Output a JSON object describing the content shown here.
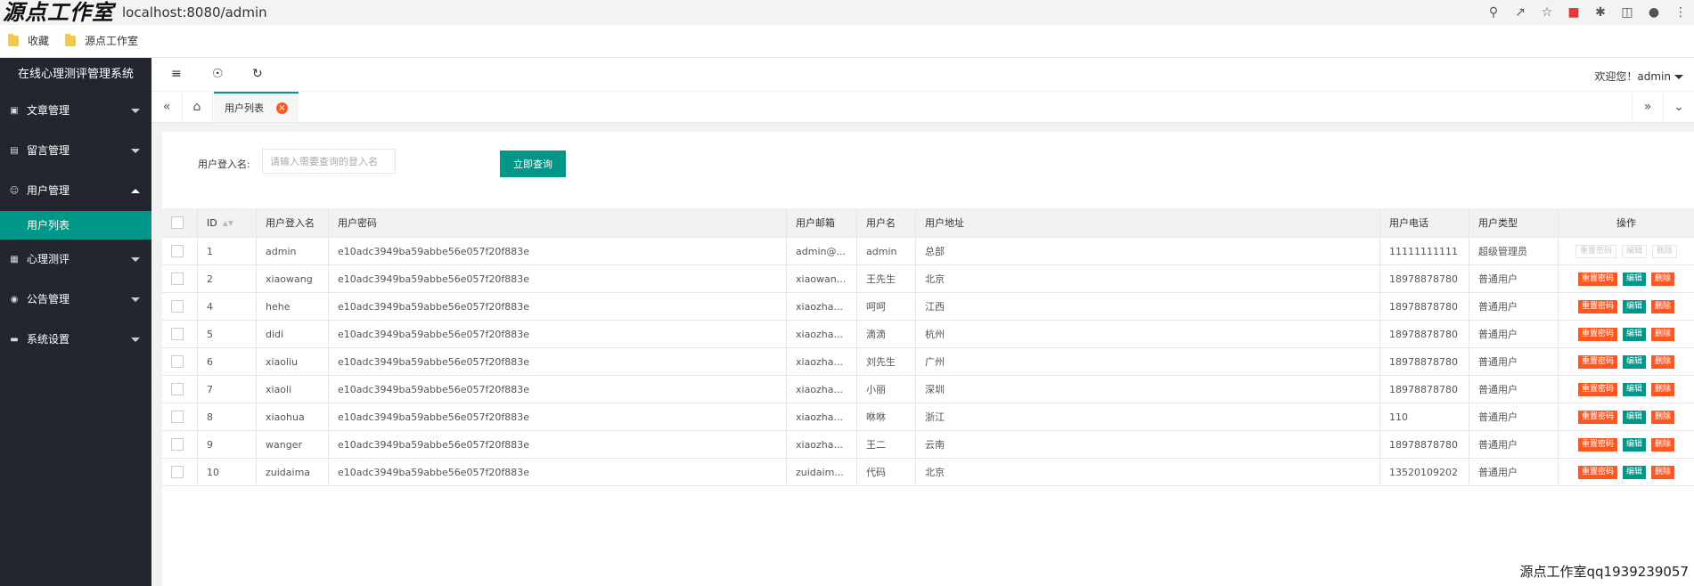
{
  "browser": {
    "logo": "源点工作室",
    "url": "localhost:8080/admin",
    "bookmarks": [
      "收藏",
      "源点工作室"
    ]
  },
  "sidebar": {
    "title": "在线心理测评管理系统",
    "items": [
      {
        "label": "文章管理",
        "icon": "article-icon"
      },
      {
        "label": "留言管理",
        "icon": "message-icon"
      },
      {
        "label": "用户管理",
        "icon": "user-icon",
        "expanded": true
      },
      {
        "label": "心理测评",
        "icon": "assessment-icon"
      },
      {
        "label": "公告管理",
        "icon": "notice-icon"
      },
      {
        "label": "系统设置",
        "icon": "settings-icon"
      }
    ],
    "active_sub": "用户列表"
  },
  "header": {
    "welcome": "欢迎您！admin"
  },
  "tabs": {
    "active": "用户列表"
  },
  "search": {
    "label": "用户登入名:",
    "placeholder": "请输入需要查询的登入名",
    "button": "立即查询"
  },
  "table": {
    "columns": [
      "ID",
      "用户登入名",
      "用户密码",
      "用户邮箱",
      "用户名",
      "用户地址",
      "用户电话",
      "用户类型",
      "操作"
    ],
    "rows": [
      [
        "1",
        "admin",
        "e10adc3949ba59abbe56e057f20f883e",
        "admin@...",
        "admin",
        "总部",
        "11111111111",
        "超级管理员"
      ],
      [
        "2",
        "xiaowang",
        "e10adc3949ba59abbe56e057f20f883e",
        "xiaowan...",
        "王先生",
        "北京",
        "18978878780",
        "普通用户"
      ],
      [
        "4",
        "hehe",
        "e10adc3949ba59abbe56e057f20f883e",
        "xiaozha...",
        "呵呵",
        "江西",
        "18978878780",
        "普通用户"
      ],
      [
        "5",
        "didi",
        "e10adc3949ba59abbe56e057f20f883e",
        "xiaozha...",
        "滴滴",
        "杭州",
        "18978878780",
        "普通用户"
      ],
      [
        "6",
        "xiaoliu",
        "e10adc3949ba59abbe56e057f20f883e",
        "xiaozha...",
        "刘先生",
        "广州",
        "18978878780",
        "普通用户"
      ],
      [
        "7",
        "xiaoli",
        "e10adc3949ba59abbe56e057f20f883e",
        "xiaozha...",
        "小丽",
        "深圳",
        "18978878780",
        "普通用户"
      ],
      [
        "8",
        "xiaohua",
        "e10adc3949ba59abbe56e057f20f883e",
        "xiaozha...",
        "咻咻",
        "浙江",
        "110",
        "普通用户"
      ],
      [
        "9",
        "wanger",
        "e10adc3949ba59abbe56e057f20f883e",
        "xiaozha...",
        "王二",
        "云南",
        "18978878780",
        "普通用户"
      ],
      [
        "10",
        "zuidaima",
        "e10adc3949ba59abbe56e057f20f883e",
        "zuidaim...",
        "代码",
        "北京",
        "13520109202",
        "普通用户"
      ]
    ],
    "actions": {
      "reset": "重置密码",
      "edit": "编辑",
      "delete": "删除"
    },
    "disabled_rows": [
      0
    ]
  },
  "watermark": "源点工作室qq1939239057",
  "colors": {
    "primary": "#009688",
    "danger": "#ff5722",
    "sidebar": "#23262e"
  }
}
